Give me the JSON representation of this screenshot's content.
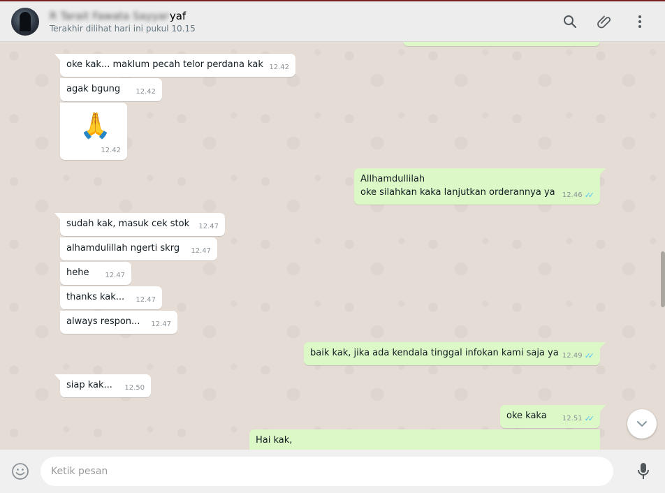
{
  "header": {
    "contact_name_hidden": "R Tarait Fawata Sayyar",
    "contact_name_visible": "yaf",
    "last_seen": "Terakhir dilihat hari ini pukul 10.15",
    "icons": [
      "search-icon",
      "attach-icon",
      "menu-icon"
    ]
  },
  "messages": [
    {
      "dir": "in",
      "text": "oke kak... maklum pecah telor perdana kak",
      "time": "12.42"
    },
    {
      "dir": "in",
      "text": "agak bgung",
      "time": "12.42"
    },
    {
      "dir": "in",
      "emoji": "🙏",
      "time": "12.42"
    },
    {
      "dir": "out",
      "text": "Allhamdullilah",
      "text2": "oke silahkan kaka lanjutkan orderannya ya",
      "time": "12.46"
    },
    {
      "dir": "in",
      "text": "sudah kak, masuk cek stok",
      "time": "12.47"
    },
    {
      "dir": "in",
      "text": "alhamdulillah ngerti skrg",
      "time": "12.47"
    },
    {
      "dir": "in",
      "text": "hehe",
      "time": "12.47"
    },
    {
      "dir": "in",
      "text": "thanks kak...",
      "time": "12.47"
    },
    {
      "dir": "in",
      "text": "always respon...",
      "time": "12.47"
    },
    {
      "dir": "out",
      "text": "baik kak, jika ada kendala tinggal infokan kami saja ya",
      "time": "12.49"
    },
    {
      "dir": "in",
      "text": "siap kak...",
      "time": "12.50"
    },
    {
      "dir": "out",
      "text": "oke kaka",
      "time": "12.51"
    },
    {
      "dir": "out",
      "text": "Hai kak,"
    }
  ],
  "composer": {
    "placeholder": "Ketik pesan",
    "value": ""
  },
  "colors": {
    "outgoing_bubble": "#dcf8c6",
    "incoming_bubble": "#ffffff",
    "chat_background": "#e5ddd5",
    "read_tick": "#4fc3f7"
  }
}
